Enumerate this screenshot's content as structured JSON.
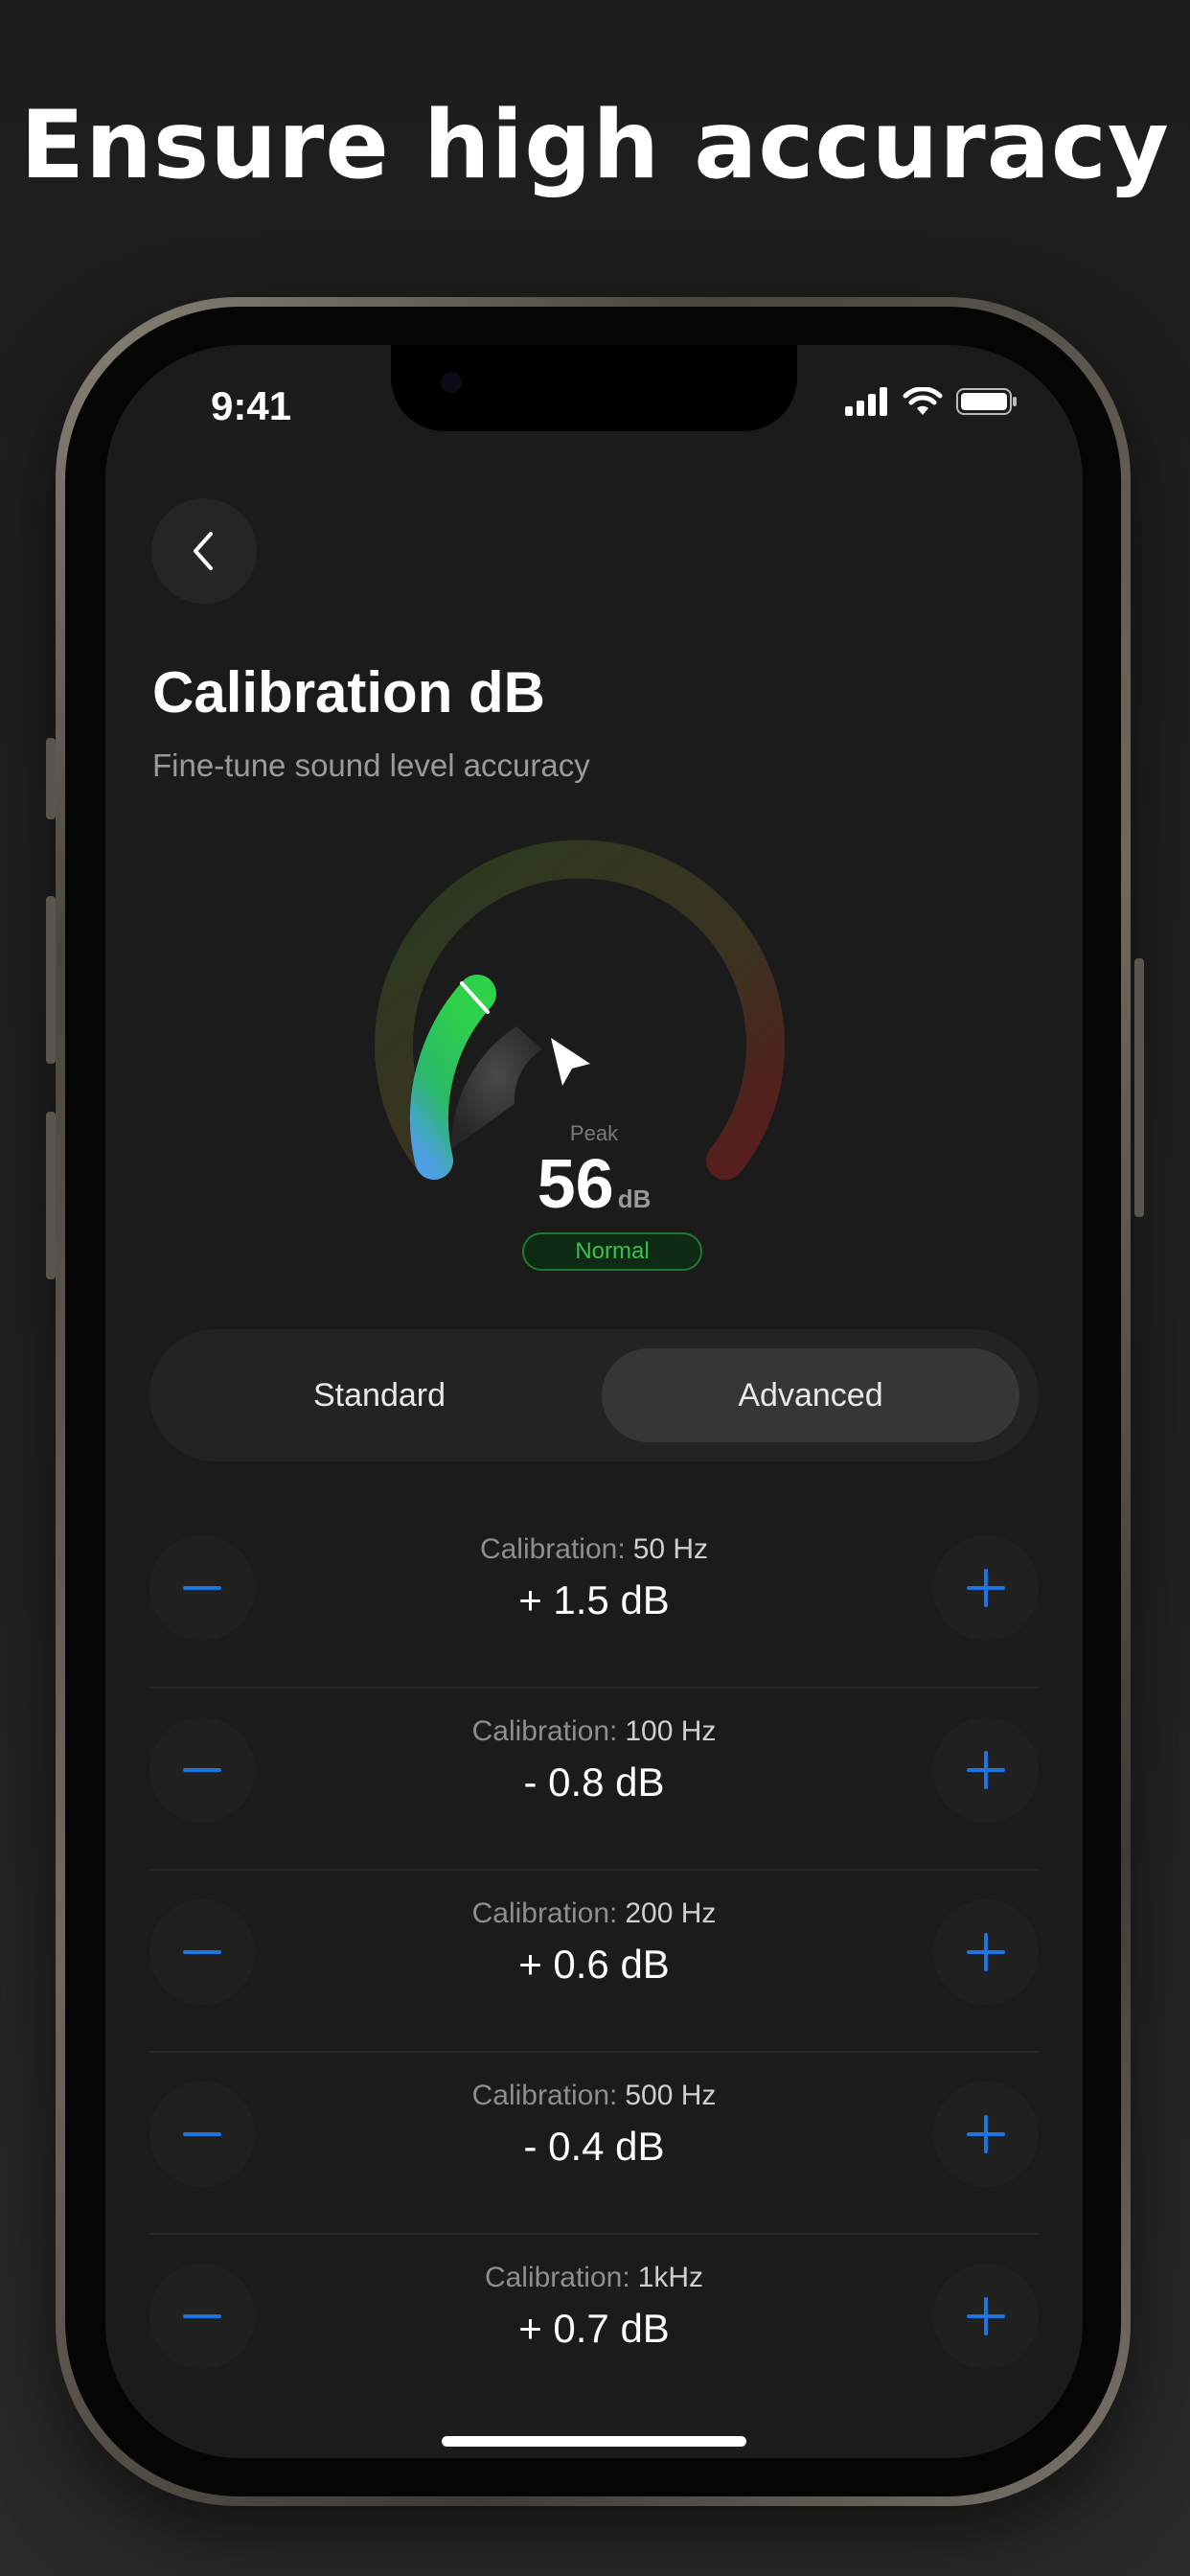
{
  "headline": "Ensure high accuracy",
  "status": {
    "time": "9:41"
  },
  "page": {
    "title": "Calibration dB",
    "subtitle": "Fine-tune sound level accuracy"
  },
  "gauge": {
    "label": "Peak",
    "value": "56",
    "unit": "dB",
    "status": "Normal",
    "level_fraction": 0.28
  },
  "tabs": {
    "standard": "Standard",
    "advanced": "Advanced",
    "selected": "Advanced"
  },
  "calibrations": [
    {
      "label": "Calibration:",
      "freq": "50 Hz",
      "value": "+ 1.5 dB"
    },
    {
      "label": "Calibration:",
      "freq": "100 Hz",
      "value": "- 0.8 dB"
    },
    {
      "label": "Calibration:",
      "freq": "200 Hz",
      "value": "+ 0.6 dB"
    },
    {
      "label": "Calibration:",
      "freq": "500 Hz",
      "value": "- 0.4 dB"
    },
    {
      "label": "Calibration:",
      "freq": "1kHz",
      "value": "+ 0.7 dB"
    }
  ],
  "colors": {
    "accent": "#1e74e0",
    "normal": "#38c24d",
    "background": "#1b1b1b"
  },
  "icons": {
    "back": "chevron-left-icon",
    "minus": "minus-icon",
    "plus": "plus-icon",
    "pointer": "cursor-arrow-icon"
  }
}
